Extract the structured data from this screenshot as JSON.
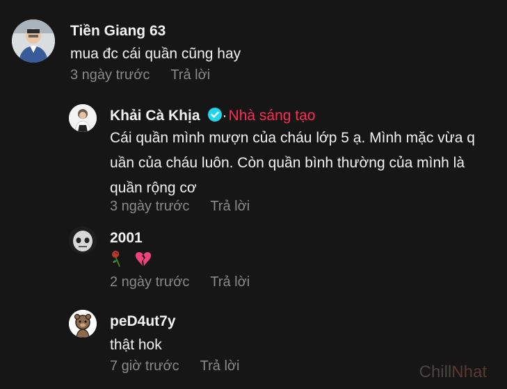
{
  "comments": [
    {
      "username": "Tiền Giang 63",
      "text": "mua đc cái quần cũng hay",
      "time": "3 ngày trước",
      "reply": "Trả lời"
    },
    {
      "username": "Khải Cà Khịa",
      "dot": "·",
      "badge": "Nhà sáng tạo",
      "lines": [
        "Cái quần mình mượn của cháu lớp 5 ạ. Mình mặc vừa q",
        "uần của cháu luôn. Còn quần bình thường của mình là",
        "quần rộng cơ"
      ],
      "time": "3 ngày trước",
      "reply": "Trả lời"
    },
    {
      "username": "2001",
      "emojis": [
        "wilted-rose-emoji",
        "broken-heart-emoji"
      ],
      "time": "2 ngày trước",
      "reply": "Trả lời"
    },
    {
      "username": "peD4ut7y",
      "text": "thật hok",
      "time": "7 giờ trước",
      "reply": "Trả lời"
    }
  ],
  "watermark": {
    "part1": "Chill",
    "part2": "Nhat"
  },
  "colors": {
    "background": "#161616",
    "creator_badge": "#fe2c55",
    "verified": "#20d5ec",
    "meta": "#8a8a8a"
  }
}
